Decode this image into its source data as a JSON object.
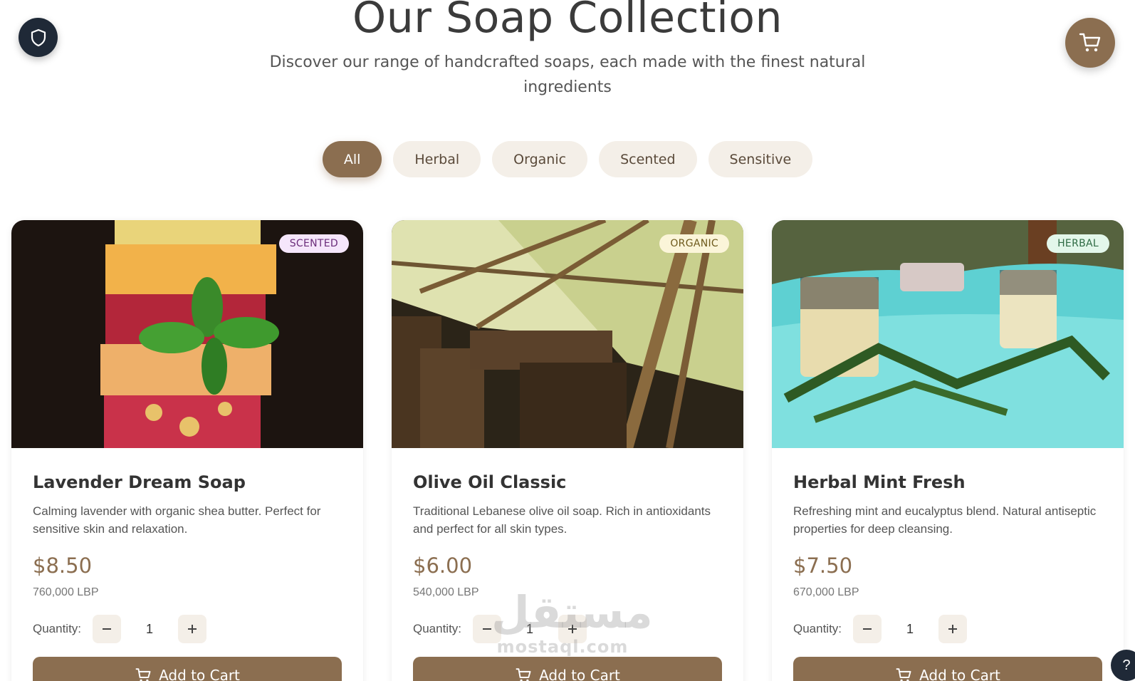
{
  "header": {
    "title": "Our Soap Collection",
    "subtitle": "Discover our range of handcrafted soaps, each made with the finest natural ingredients"
  },
  "filters": [
    {
      "label": "All",
      "active": true
    },
    {
      "label": "Herbal",
      "active": false
    },
    {
      "label": "Organic",
      "active": false
    },
    {
      "label": "Scented",
      "active": false
    },
    {
      "label": "Sensitive",
      "active": false
    }
  ],
  "products": [
    {
      "name": "Lavender Dream Soap",
      "badge": "SCENTED",
      "description": "Calming lavender with organic shea butter. Perfect for sensitive skin and relaxation.",
      "price": "$8.50",
      "price_lbp": "760,000 LBP",
      "quantity_label": "Quantity:",
      "quantity": "1",
      "add_label": "Add to Cart"
    },
    {
      "name": "Olive Oil Classic",
      "badge": "ORGANIC",
      "description": "Traditional Lebanese olive oil soap. Rich in antioxidants and perfect for all skin types.",
      "price": "$6.00",
      "price_lbp": "540,000 LBP",
      "quantity_label": "Quantity:",
      "quantity": "1",
      "add_label": "Add to Cart"
    },
    {
      "name": "Herbal Mint Fresh",
      "badge": "HERBAL",
      "description": "Refreshing mint and eucalyptus blend. Natural antiseptic properties for deep cleansing.",
      "price": "$7.50",
      "price_lbp": "670,000 LBP",
      "quantity_label": "Quantity:",
      "quantity": "1",
      "add_label": "Add to Cart"
    }
  ],
  "watermark": {
    "arabic": "مستقل",
    "latin": "mostaql.com"
  },
  "help": {
    "label": "?"
  },
  "icons": {
    "shield": "shield-icon",
    "cart": "cart-icon",
    "minus": "minus-icon",
    "plus": "plus-icon",
    "help": "help-icon"
  },
  "colors": {
    "accent": "#8b6e50",
    "dark": "#1f2937",
    "chip_bg": "#f4efe8"
  }
}
